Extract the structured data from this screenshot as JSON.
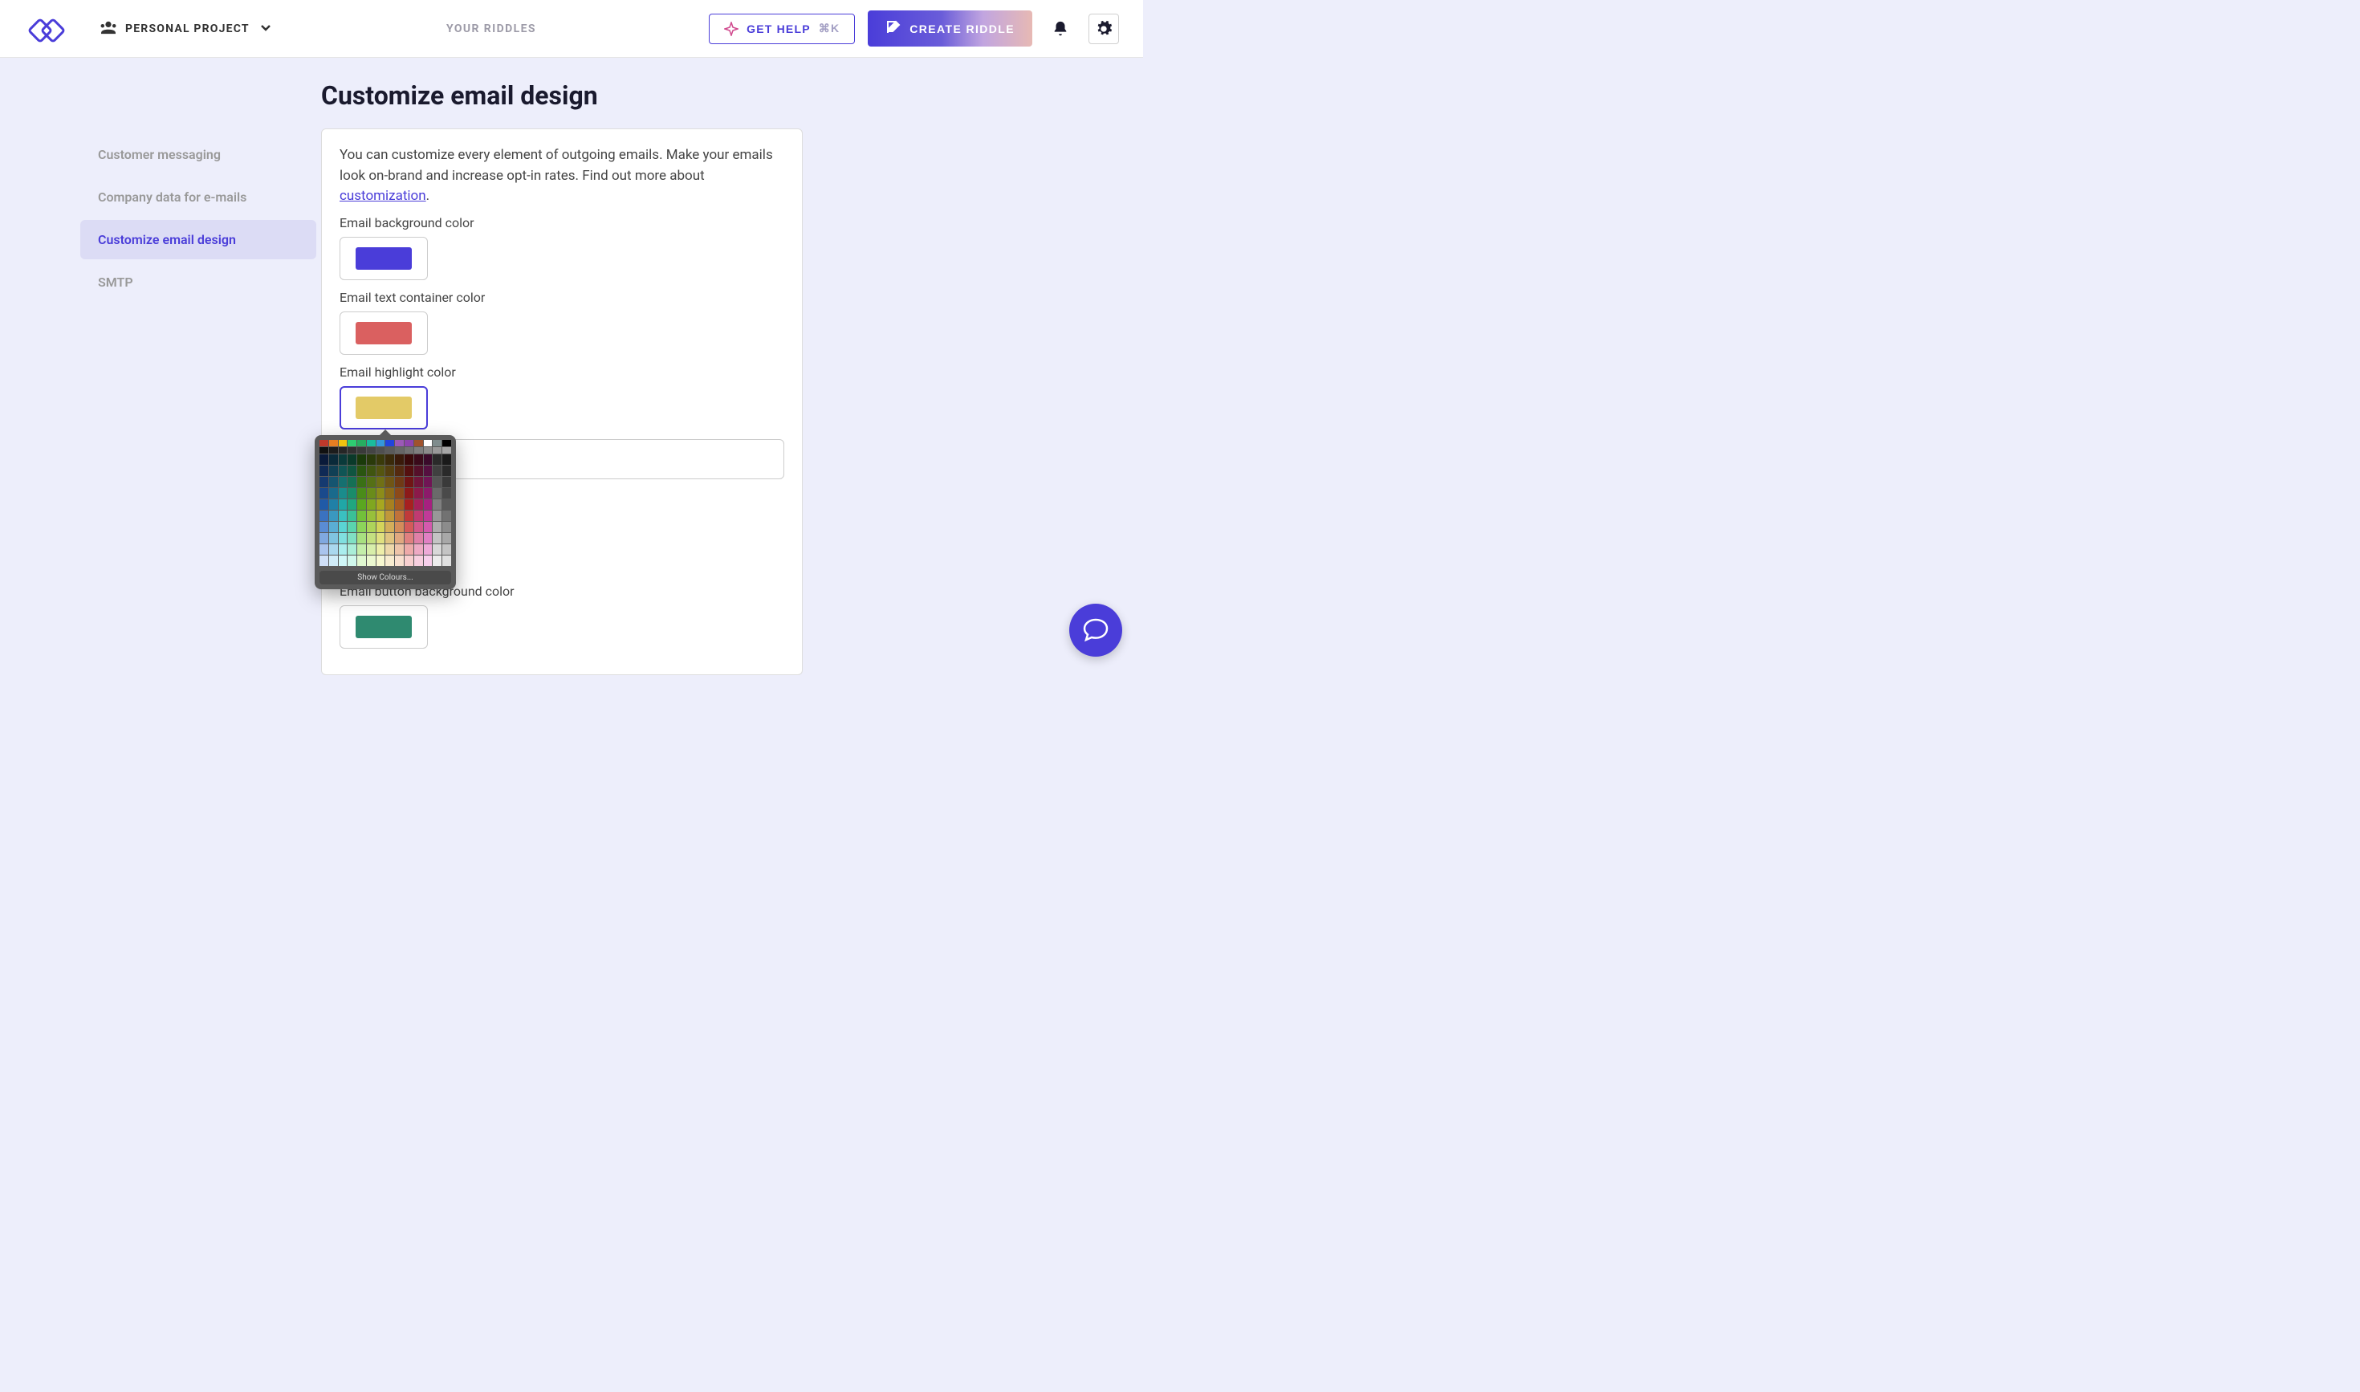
{
  "topbar": {
    "project_label": "PERSONAL PROJECT",
    "center_link": "YOUR RIDDLES",
    "help_label": "GET HELP",
    "help_shortcut": "⌘K",
    "create_label": "CREATE RIDDLE"
  },
  "sidebar": {
    "items": [
      {
        "label": "Customer messaging",
        "active": false
      },
      {
        "label": "Company data for e-mails",
        "active": false
      },
      {
        "label": "Customize email design",
        "active": true
      },
      {
        "label": "SMTP",
        "active": false
      }
    ]
  },
  "page": {
    "title": "Customize email design",
    "description_pre": "You can customize every element of outgoing emails. Make your emails look on-brand and increase opt-in rates. Find out more about ",
    "description_link": "customization",
    "description_post": ".",
    "fields": {
      "bg": {
        "label": "Email background color",
        "value": "#4a3dd9"
      },
      "container": {
        "label": "Email text container color",
        "value": "#da6060"
      },
      "highlight": {
        "label": "Email highlight color",
        "value": "#e3ca67"
      },
      "text_input_value": "",
      "button_bg": {
        "label": "Email button background color",
        "value": "#2f8a70"
      }
    }
  },
  "picker": {
    "footer": "Show Colours...",
    "row_basic": [
      "#c0392b",
      "#e67e22",
      "#f1c40f",
      "#2ecc71",
      "#27ae60",
      "#1abc9c",
      "#3498db",
      "#2244dd",
      "#9b59b6",
      "#8e44ad",
      "#a0522d",
      "#ffffff",
      "#7f8c8d",
      "#000000"
    ],
    "row_gray": [
      "#111",
      "#1c1c1c",
      "#262626",
      "#303030",
      "#3a3a3a",
      "#444",
      "#4f4f4f",
      "#5a5a5a",
      "#666",
      "#727272",
      "#7f7f7f",
      "#8c8c8c",
      "#999",
      "#a6a6a6"
    ],
    "rows_body": [
      [
        "#0a1a3a",
        "#0a2a3a",
        "#0a3a3a",
        "#0a3a2a",
        "#1a3a0a",
        "#2a3a0a",
        "#3a3a0a",
        "#3a2a0a",
        "#3a1a0a",
        "#3a0a0a",
        "#3a0a1a",
        "#3a0a2a",
        "#2a2a2a",
        "#1a1a1a"
      ],
      [
        "#102a55",
        "#104055",
        "#105555",
        "#105540",
        "#2a5510",
        "#405510",
        "#555510",
        "#554010",
        "#552a10",
        "#551010",
        "#55102a",
        "#551040",
        "#404040",
        "#2a2a2a"
      ],
      [
        "#153a70",
        "#155570",
        "#157070",
        "#157055",
        "#3a7015",
        "#557015",
        "#707015",
        "#705515",
        "#703a15",
        "#701515",
        "#70153a",
        "#701555",
        "#555555",
        "#3a3a3a"
      ],
      [
        "#1a4a8c",
        "#1a6a8c",
        "#1a8c8c",
        "#1a8c6a",
        "#4a8c1a",
        "#6a8c1a",
        "#8c8c1a",
        "#8c6a1a",
        "#8c4a1a",
        "#8c1a1a",
        "#8c1a4a",
        "#8c1a6a",
        "#6a6a6a",
        "#4a4a4a"
      ],
      [
        "#205aa7",
        "#2080a7",
        "#20a7a7",
        "#20a780",
        "#5aa720",
        "#80a720",
        "#a7a720",
        "#a78020",
        "#a75a20",
        "#a72020",
        "#a7205a",
        "#a72080",
        "#808080",
        "#5a5a5a"
      ],
      [
        "#3a72c0",
        "#3a98c0",
        "#3ac0c0",
        "#3ac098",
        "#72c03a",
        "#98c03a",
        "#c0c03a",
        "#c0983a",
        "#c0723a",
        "#c03a3a",
        "#c03a72",
        "#c03a98",
        "#989898",
        "#727272"
      ],
      [
        "#5a8cd4",
        "#5aaed4",
        "#5ad4d4",
        "#5ad4ae",
        "#8cd45a",
        "#aed45a",
        "#d4d45a",
        "#d4ae5a",
        "#d48c5a",
        "#d45a5a",
        "#d45a8c",
        "#d45aae",
        "#aeaeae",
        "#8c8c8c"
      ],
      [
        "#80a8e0",
        "#80c4e0",
        "#80e0e0",
        "#80e0c4",
        "#a8e080",
        "#c4e080",
        "#e0e080",
        "#e0c480",
        "#e0a880",
        "#e08080",
        "#e080a8",
        "#e080c4",
        "#c4c4c4",
        "#a8a8a8"
      ],
      [
        "#aac4ee",
        "#aad8ee",
        "#aaeeee",
        "#aaeed8",
        "#c4eeaa",
        "#d8eeaa",
        "#eeeeaa",
        "#eed8aa",
        "#eec4aa",
        "#eeaaaa",
        "#eeaac4",
        "#eeaad8",
        "#d8d8d8",
        "#c4c4c4"
      ],
      [
        "#d0e0f8",
        "#d0ecf8",
        "#d0f8f8",
        "#d0f8ec",
        "#e0f8d0",
        "#ecf8d0",
        "#f8f8d0",
        "#f8ecd0",
        "#f8e0d0",
        "#f8d0d0",
        "#f8d0e0",
        "#f8d0ec",
        "#ececec",
        "#e0e0e0"
      ]
    ]
  }
}
